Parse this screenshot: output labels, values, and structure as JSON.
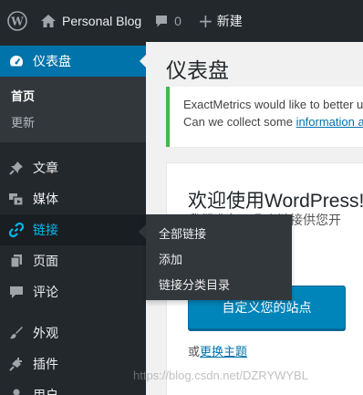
{
  "adminbar": {
    "site_name": "Personal Blog",
    "comment_count": "0",
    "new_label": "新建"
  },
  "sidebar": {
    "dashboard": "仪表盘",
    "dashboard_sub": [
      "首页",
      "更新"
    ],
    "items": [
      "文章",
      "媒体",
      "链接",
      "页面",
      "评论",
      "外观",
      "插件",
      "用户"
    ]
  },
  "flyout": {
    "items": [
      "全部链接",
      "添加",
      "链接分类目录"
    ]
  },
  "main": {
    "title": "仪表盘",
    "notice_line1": "ExactMetrics would like to better u",
    "notice_line2_prefix": "Can we collect some ",
    "notice_link": "information a",
    "welcome_title": "欢迎使用WordPress!",
    "welcome_sub": "我们准备了几个链接供您开",
    "customize_button": "自定义您的站点",
    "change_theme_prefix": "或",
    "change_theme_link": "更换主题"
  },
  "watermark": "https://blog.csdn.net/DZRYWYBL",
  "colors": {
    "adminbar_bg": "#23282d",
    "active_menu": "#0073aa",
    "link_accent": "#00b9eb",
    "notice_border": "#46b450",
    "button": "#0085ba"
  }
}
